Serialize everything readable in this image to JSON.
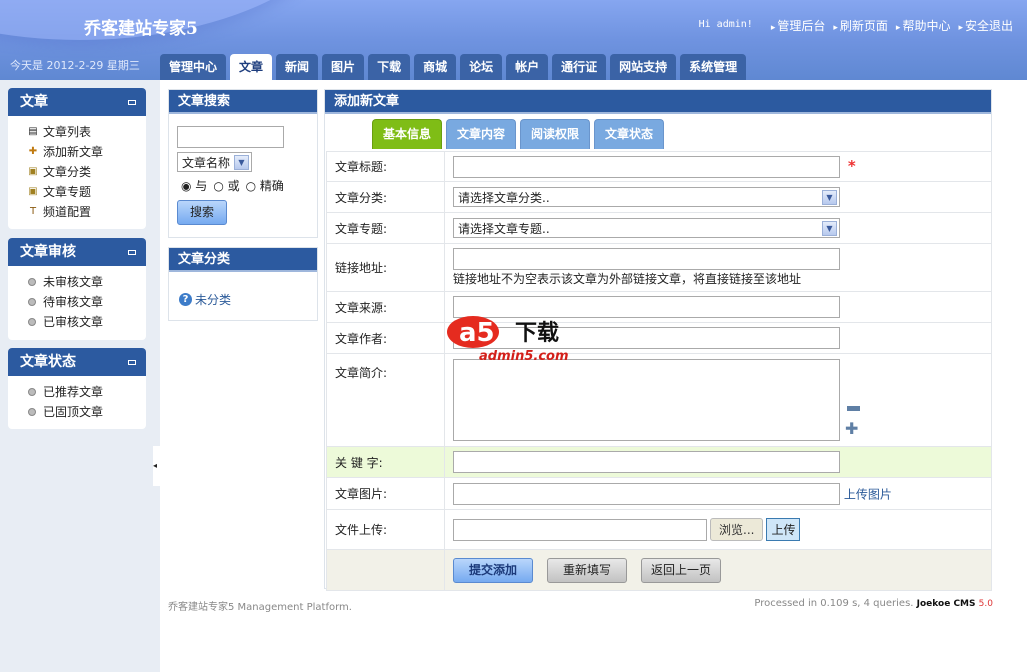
{
  "header": {
    "logo": "乔客建站专家5",
    "greeting": "Hi admin!",
    "links": [
      "管理后台",
      "刷新页面",
      "帮助中心",
      "安全退出"
    ],
    "date": "今天是 2012-2-29 星期三"
  },
  "nav": [
    "管理中心",
    "文章",
    "新闻",
    "图片",
    "下载",
    "商城",
    "论坛",
    "帐户",
    "通行证",
    "网站支持",
    "系统管理"
  ],
  "sidebar": [
    {
      "title": "文章",
      "items": [
        "文章列表",
        "添加新文章",
        "文章分类",
        "文章专题",
        "频道配置"
      ]
    },
    {
      "title": "文章审核",
      "items": [
        "未审核文章",
        "待审核文章",
        "已审核文章"
      ]
    },
    {
      "title": "文章状态",
      "items": [
        "已推荐文章",
        "已固顶文章"
      ]
    }
  ],
  "search": {
    "title": "文章搜索",
    "field": "文章名称",
    "radios": [
      "与",
      "或",
      "精确"
    ],
    "button": "搜索"
  },
  "category": {
    "title": "文章分类",
    "item": "未分类"
  },
  "main": {
    "title": "添加新文章",
    "tabs": [
      "基本信息",
      "文章内容",
      "阅读权限",
      "文章状态"
    ],
    "labels": {
      "title": "文章标题:",
      "category": "文章分类:",
      "topic": "文章专题:",
      "link": "链接地址:",
      "source": "文章来源:",
      "author": "文章作者:",
      "summary": "文章简介:",
      "keywords": "关 键 字:",
      "image": "文章图片:",
      "upload": "文件上传:"
    },
    "category_placeholder": "请选择文章分类..",
    "topic_placeholder": "请选择文章专题..",
    "link_hint": "链接地址不为空表示该文章为外部链接文章，将直接链接至该地址",
    "required": "*",
    "upload_image": "上传图片",
    "browse": "浏览...",
    "upload": "上传",
    "buttons": {
      "submit": "提交添加",
      "reset": "重新填写",
      "back": "返回上一页"
    }
  },
  "footer": {
    "left": "乔客建站专家5 Management Platform.",
    "right": "Processed in 0.109 s, 4 queries.",
    "brand": "Joekoe CMS",
    "version": "5.0"
  },
  "watermark": {
    "text": "a5下载",
    "url": "admin5.com"
  }
}
